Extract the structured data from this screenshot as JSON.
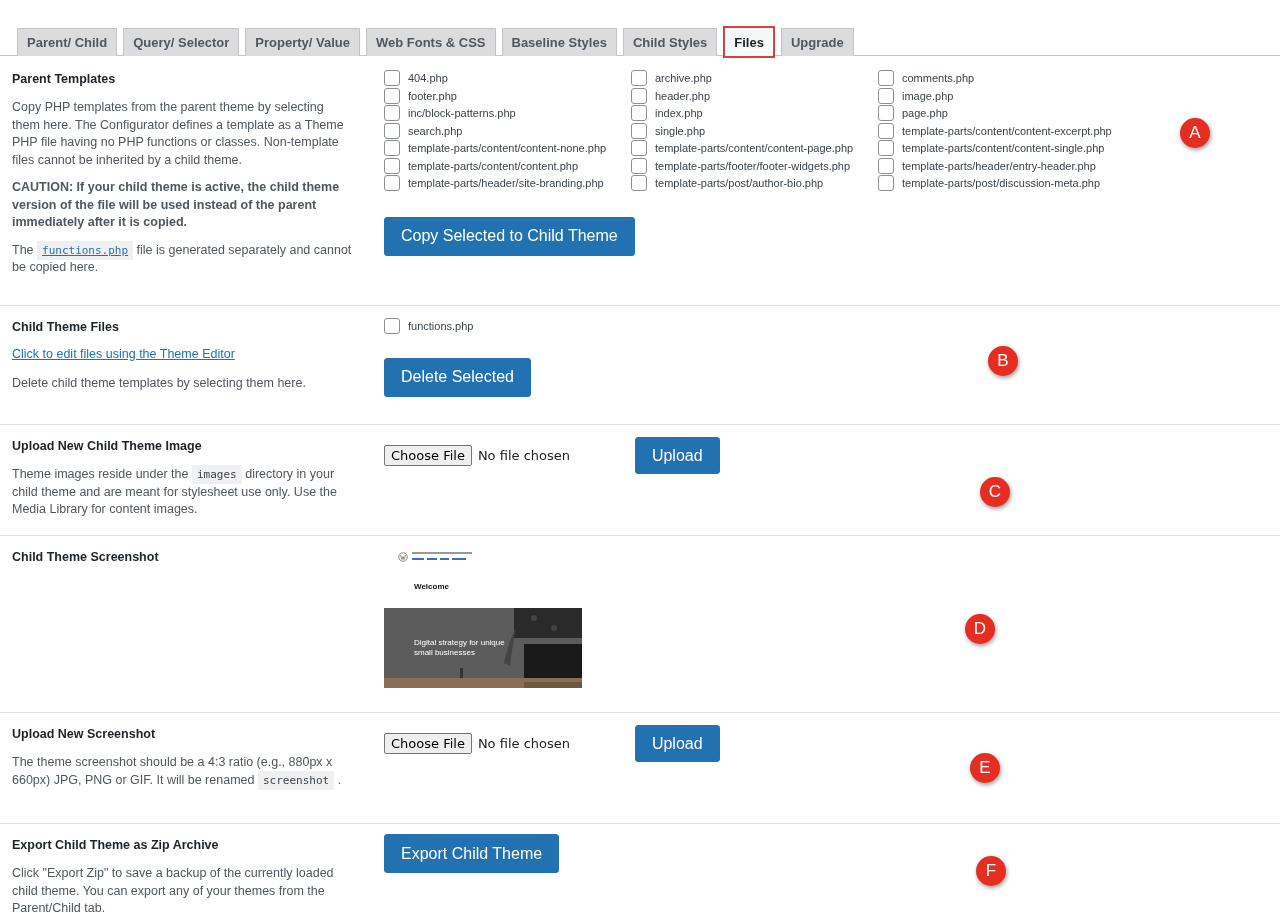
{
  "tabs": [
    {
      "label": "Parent/ Child",
      "selected": false,
      "highlighted": false
    },
    {
      "label": "Query/ Selector",
      "selected": false,
      "highlighted": false
    },
    {
      "label": "Property/ Value",
      "selected": false,
      "highlighted": false
    },
    {
      "label": "Web Fonts & CSS",
      "selected": false,
      "highlighted": false
    },
    {
      "label": "Baseline Styles",
      "selected": false,
      "highlighted": false
    },
    {
      "label": "Child Styles",
      "selected": false,
      "highlighted": false
    },
    {
      "label": "Files",
      "selected": true,
      "highlighted": true
    },
    {
      "label": "Upgrade",
      "selected": false,
      "highlighted": false
    }
  ],
  "sections": [
    {
      "kind": "templates",
      "title": "Parent Templates",
      "marker": "A",
      "paragraphs": [
        "Copy PHP templates from the parent theme by selecting them here. The Configurator defines a template as a Theme PHP file having no PHP functions or classes. Non-template files cannot be inherited by a child theme.",
        "**CAUTION: If your child theme is active, the child theme version of the file will be used instead of the parent immediately after it is copied.**"
      ],
      "code_note": {
        "before": "The",
        "code": "functions.php",
        "after": "file is generated separately and cannot be copied here."
      },
      "files": [
        {
          "name": "404.php",
          "checked": false
        },
        {
          "name": "archive.php",
          "checked": false
        },
        {
          "name": "comments.php",
          "checked": false
        },
        {
          "name": "footer.php",
          "checked": false
        },
        {
          "name": "header.php",
          "checked": false
        },
        {
          "name": "image.php",
          "checked": false
        },
        {
          "name": "inc/block-patterns.php",
          "checked": false
        },
        {
          "name": "index.php",
          "checked": false
        },
        {
          "name": "page.php",
          "checked": false
        },
        {
          "name": "search.php",
          "checked": false
        },
        {
          "name": "single.php",
          "checked": false
        },
        {
          "name": "template-parts/content/content-excerpt.php",
          "checked": false
        },
        {
          "name": "template-parts/content/content-none.php",
          "checked": false
        },
        {
          "name": "template-parts/content/content-page.php",
          "checked": false
        },
        {
          "name": "template-parts/content/content-single.php",
          "checked": false
        },
        {
          "name": "template-parts/content/content.php",
          "checked": false
        },
        {
          "name": "template-parts/footer/footer-widgets.php",
          "checked": false
        },
        {
          "name": "template-parts/header/entry-header.php",
          "checked": false
        },
        {
          "name": "template-parts/header/site-branding.php",
          "checked": false
        },
        {
          "name": "template-parts/post/author-bio.php",
          "checked": false
        },
        {
          "name": "template-parts/post/discussion-meta.php",
          "checked": false
        }
      ],
      "button": "Copy Selected to Child Theme"
    },
    {
      "kind": "child_files",
      "title": "Child Theme Files",
      "marker": "B",
      "link": "Click to edit files using the Theme Editor",
      "paragraphs": [
        "Delete child theme templates by selecting them here."
      ],
      "files": [
        {
          "name": "functions.php",
          "checked": false
        }
      ],
      "button": "Delete Selected"
    },
    {
      "kind": "upload",
      "title": "Upload New Child Theme Image",
      "marker": "C",
      "code_note": {
        "before": "Theme images reside under the",
        "code": "images",
        "after": "directory in your child theme and are meant for stylesheet use only. Use the Media Library for content images."
      },
      "file_button": "Choose File",
      "file_status": "No file chosen",
      "button": "Upload"
    },
    {
      "kind": "screenshot",
      "title": "Child Theme Screenshot",
      "marker": "D",
      "preview": {
        "heading": "Welcome",
        "hero_text": "Digital strategy for unique small businesses"
      }
    },
    {
      "kind": "upload",
      "title": "Upload New Screenshot",
      "marker": "E",
      "code_note": {
        "before": "The theme screenshot should be a 4:3 ratio (e.g., 880px x 660px) JPG, PNG or GIF. It will be renamed",
        "code": "screenshot",
        "after": "."
      },
      "file_button": "Choose File",
      "file_status": "No file chosen",
      "button": "Upload"
    },
    {
      "kind": "export",
      "title": "Export Child Theme as Zip Archive",
      "marker": "F",
      "paragraphs": [
        "Click \"Export Zip\" to save a backup of the currently loaded child theme. You can export any of your themes from the Parent/Child tab."
      ],
      "button": "Export Child Theme"
    }
  ]
}
